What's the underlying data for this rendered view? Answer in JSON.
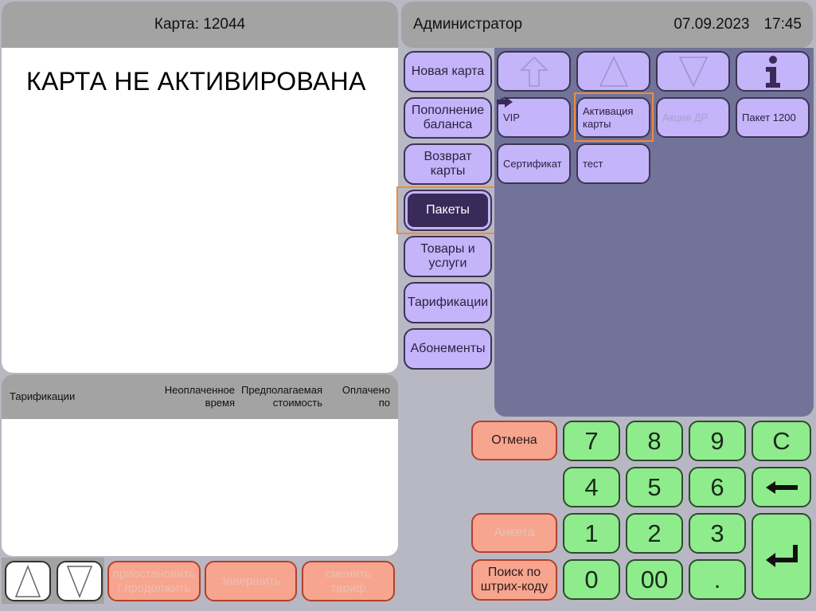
{
  "card": {
    "title": "Карта: 12044",
    "status": "КАРТА НЕ АКТИВИРОВАНА"
  },
  "tariff_table": {
    "columns": [
      "Тарификации",
      "Неоплаченное\nвремя",
      "Предполагаемая\nстоимость",
      "Оплачено\nпо"
    ],
    "rows": []
  },
  "header": {
    "user": "Администратор",
    "date": "07.09.2023",
    "time": "17:45"
  },
  "categories": [
    {
      "label": "Новая карта",
      "active": false
    },
    {
      "label": "Пополнение\nбаланса",
      "active": false
    },
    {
      "label": "Возврат\nкарты",
      "active": false
    },
    {
      "label": "Пакеты",
      "active": true
    },
    {
      "label": "Товары и\nуслуги",
      "active": false
    },
    {
      "label": "Тарификации",
      "active": false
    },
    {
      "label": "Абонементы",
      "active": false
    }
  ],
  "nav_icons": [
    "scroll-top-icon",
    "arrow-up-icon",
    "arrow-down-icon",
    "info-icon"
  ],
  "items": [
    {
      "label": "VIP",
      "disabled": false
    },
    {
      "label": "Активация\nкарты",
      "disabled": false
    },
    {
      "label": "Акция ДР",
      "disabled": true
    },
    {
      "label": "Пакет 1200",
      "disabled": false
    },
    {
      "label": "Сертификат",
      "disabled": false
    },
    {
      "label": "тест",
      "disabled": false
    }
  ],
  "actions": {
    "cancel": "Отмена",
    "survey": "Анкета",
    "barcode": "Поиск по\nштрих-коду",
    "pause": "приостановить\n/ продолжить",
    "finish": "завершить",
    "change_tariff": "сменить\nтариф"
  },
  "keypad": {
    "k7": "7",
    "k8": "8",
    "k9": "9",
    "clear": "C",
    "k4": "4",
    "k5": "5",
    "k6": "6",
    "k1": "1",
    "k2": "2",
    "k3": "3",
    "k0": "0",
    "k00": "00",
    "dot": "."
  },
  "colors": {
    "purple_button": "#c4b4fa",
    "active_category": "#3a2a5a",
    "grid_panel": "#717399",
    "keypad_green": "#8eec8c",
    "action_salmon": "#f7a58f",
    "highlight_orange": "#f08a3c",
    "header_gray": "#a3a3a3"
  }
}
